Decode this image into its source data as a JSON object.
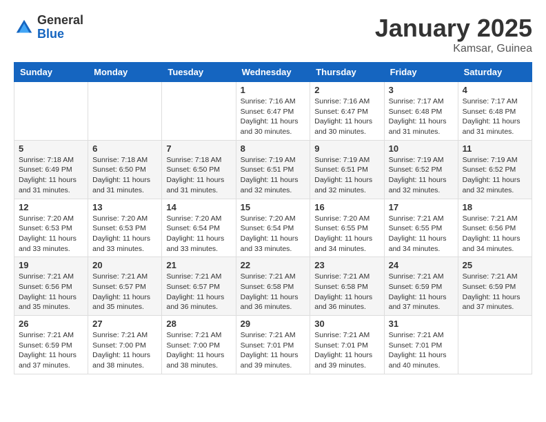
{
  "header": {
    "logo_general": "General",
    "logo_blue": "Blue",
    "month_title": "January 2025",
    "location": "Kamsar, Guinea"
  },
  "weekdays": [
    "Sunday",
    "Monday",
    "Tuesday",
    "Wednesday",
    "Thursday",
    "Friday",
    "Saturday"
  ],
  "weeks": [
    [
      {
        "day": "",
        "info": ""
      },
      {
        "day": "",
        "info": ""
      },
      {
        "day": "",
        "info": ""
      },
      {
        "day": "1",
        "info": "Sunrise: 7:16 AM\nSunset: 6:47 PM\nDaylight: 11 hours\nand 30 minutes."
      },
      {
        "day": "2",
        "info": "Sunrise: 7:16 AM\nSunset: 6:47 PM\nDaylight: 11 hours\nand 30 minutes."
      },
      {
        "day": "3",
        "info": "Sunrise: 7:17 AM\nSunset: 6:48 PM\nDaylight: 11 hours\nand 31 minutes."
      },
      {
        "day": "4",
        "info": "Sunrise: 7:17 AM\nSunset: 6:48 PM\nDaylight: 11 hours\nand 31 minutes."
      }
    ],
    [
      {
        "day": "5",
        "info": "Sunrise: 7:18 AM\nSunset: 6:49 PM\nDaylight: 11 hours\nand 31 minutes."
      },
      {
        "day": "6",
        "info": "Sunrise: 7:18 AM\nSunset: 6:50 PM\nDaylight: 11 hours\nand 31 minutes."
      },
      {
        "day": "7",
        "info": "Sunrise: 7:18 AM\nSunset: 6:50 PM\nDaylight: 11 hours\nand 31 minutes."
      },
      {
        "day": "8",
        "info": "Sunrise: 7:19 AM\nSunset: 6:51 PM\nDaylight: 11 hours\nand 32 minutes."
      },
      {
        "day": "9",
        "info": "Sunrise: 7:19 AM\nSunset: 6:51 PM\nDaylight: 11 hours\nand 32 minutes."
      },
      {
        "day": "10",
        "info": "Sunrise: 7:19 AM\nSunset: 6:52 PM\nDaylight: 11 hours\nand 32 minutes."
      },
      {
        "day": "11",
        "info": "Sunrise: 7:19 AM\nSunset: 6:52 PM\nDaylight: 11 hours\nand 32 minutes."
      }
    ],
    [
      {
        "day": "12",
        "info": "Sunrise: 7:20 AM\nSunset: 6:53 PM\nDaylight: 11 hours\nand 33 minutes."
      },
      {
        "day": "13",
        "info": "Sunrise: 7:20 AM\nSunset: 6:53 PM\nDaylight: 11 hours\nand 33 minutes."
      },
      {
        "day": "14",
        "info": "Sunrise: 7:20 AM\nSunset: 6:54 PM\nDaylight: 11 hours\nand 33 minutes."
      },
      {
        "day": "15",
        "info": "Sunrise: 7:20 AM\nSunset: 6:54 PM\nDaylight: 11 hours\nand 33 minutes."
      },
      {
        "day": "16",
        "info": "Sunrise: 7:20 AM\nSunset: 6:55 PM\nDaylight: 11 hours\nand 34 minutes."
      },
      {
        "day": "17",
        "info": "Sunrise: 7:21 AM\nSunset: 6:55 PM\nDaylight: 11 hours\nand 34 minutes."
      },
      {
        "day": "18",
        "info": "Sunrise: 7:21 AM\nSunset: 6:56 PM\nDaylight: 11 hours\nand 34 minutes."
      }
    ],
    [
      {
        "day": "19",
        "info": "Sunrise: 7:21 AM\nSunset: 6:56 PM\nDaylight: 11 hours\nand 35 minutes."
      },
      {
        "day": "20",
        "info": "Sunrise: 7:21 AM\nSunset: 6:57 PM\nDaylight: 11 hours\nand 35 minutes."
      },
      {
        "day": "21",
        "info": "Sunrise: 7:21 AM\nSunset: 6:57 PM\nDaylight: 11 hours\nand 36 minutes."
      },
      {
        "day": "22",
        "info": "Sunrise: 7:21 AM\nSunset: 6:58 PM\nDaylight: 11 hours\nand 36 minutes."
      },
      {
        "day": "23",
        "info": "Sunrise: 7:21 AM\nSunset: 6:58 PM\nDaylight: 11 hours\nand 36 minutes."
      },
      {
        "day": "24",
        "info": "Sunrise: 7:21 AM\nSunset: 6:59 PM\nDaylight: 11 hours\nand 37 minutes."
      },
      {
        "day": "25",
        "info": "Sunrise: 7:21 AM\nSunset: 6:59 PM\nDaylight: 11 hours\nand 37 minutes."
      }
    ],
    [
      {
        "day": "26",
        "info": "Sunrise: 7:21 AM\nSunset: 6:59 PM\nDaylight: 11 hours\nand 37 minutes."
      },
      {
        "day": "27",
        "info": "Sunrise: 7:21 AM\nSunset: 7:00 PM\nDaylight: 11 hours\nand 38 minutes."
      },
      {
        "day": "28",
        "info": "Sunrise: 7:21 AM\nSunset: 7:00 PM\nDaylight: 11 hours\nand 38 minutes."
      },
      {
        "day": "29",
        "info": "Sunrise: 7:21 AM\nSunset: 7:01 PM\nDaylight: 11 hours\nand 39 minutes."
      },
      {
        "day": "30",
        "info": "Sunrise: 7:21 AM\nSunset: 7:01 PM\nDaylight: 11 hours\nand 39 minutes."
      },
      {
        "day": "31",
        "info": "Sunrise: 7:21 AM\nSunset: 7:01 PM\nDaylight: 11 hours\nand 40 minutes."
      },
      {
        "day": "",
        "info": ""
      }
    ]
  ]
}
